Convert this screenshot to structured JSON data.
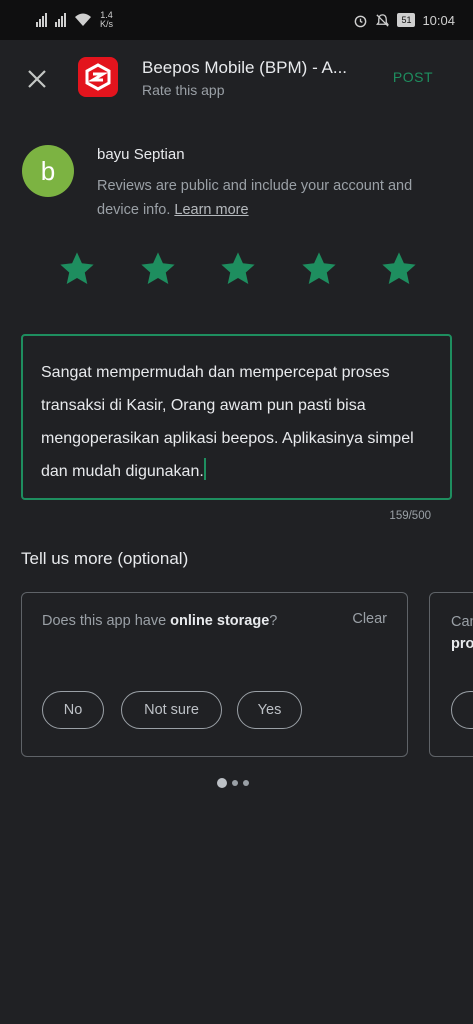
{
  "status_bar": {
    "net_speed_value": "1.4",
    "net_speed_unit": "K/s",
    "battery": "51",
    "time": "10:04"
  },
  "header": {
    "app_title": "Beepos Mobile (BPM) - A...",
    "subtitle": "Rate this app",
    "post_label": "POST"
  },
  "user": {
    "initial": "b",
    "name": "bayu Septian",
    "disclaimer": "Reviews are public and include your account and device info.",
    "learn_more": "Learn more"
  },
  "rating": {
    "value": 5,
    "max": 5,
    "color": "#1e8e5f"
  },
  "review": {
    "text": "Sangat mempermudah dan mempercepat proses transaksi di Kasir, Orang awam pun pasti bisa mengoperasikan aplikasi beepos. Aplikasinya simpel dan mudah digunakan.",
    "counter": "159/500"
  },
  "more": {
    "title": "Tell us more (optional)",
    "card1": {
      "question_prefix": "Does this app have ",
      "question_bold": "online storage",
      "question_suffix": "?",
      "clear": "Clear",
      "options": [
        "No",
        "Not sure",
        "Yes"
      ]
    },
    "card2": {
      "line1": "Can",
      "line2": "pro"
    }
  },
  "pagination": {
    "count": 3,
    "active": 1
  }
}
